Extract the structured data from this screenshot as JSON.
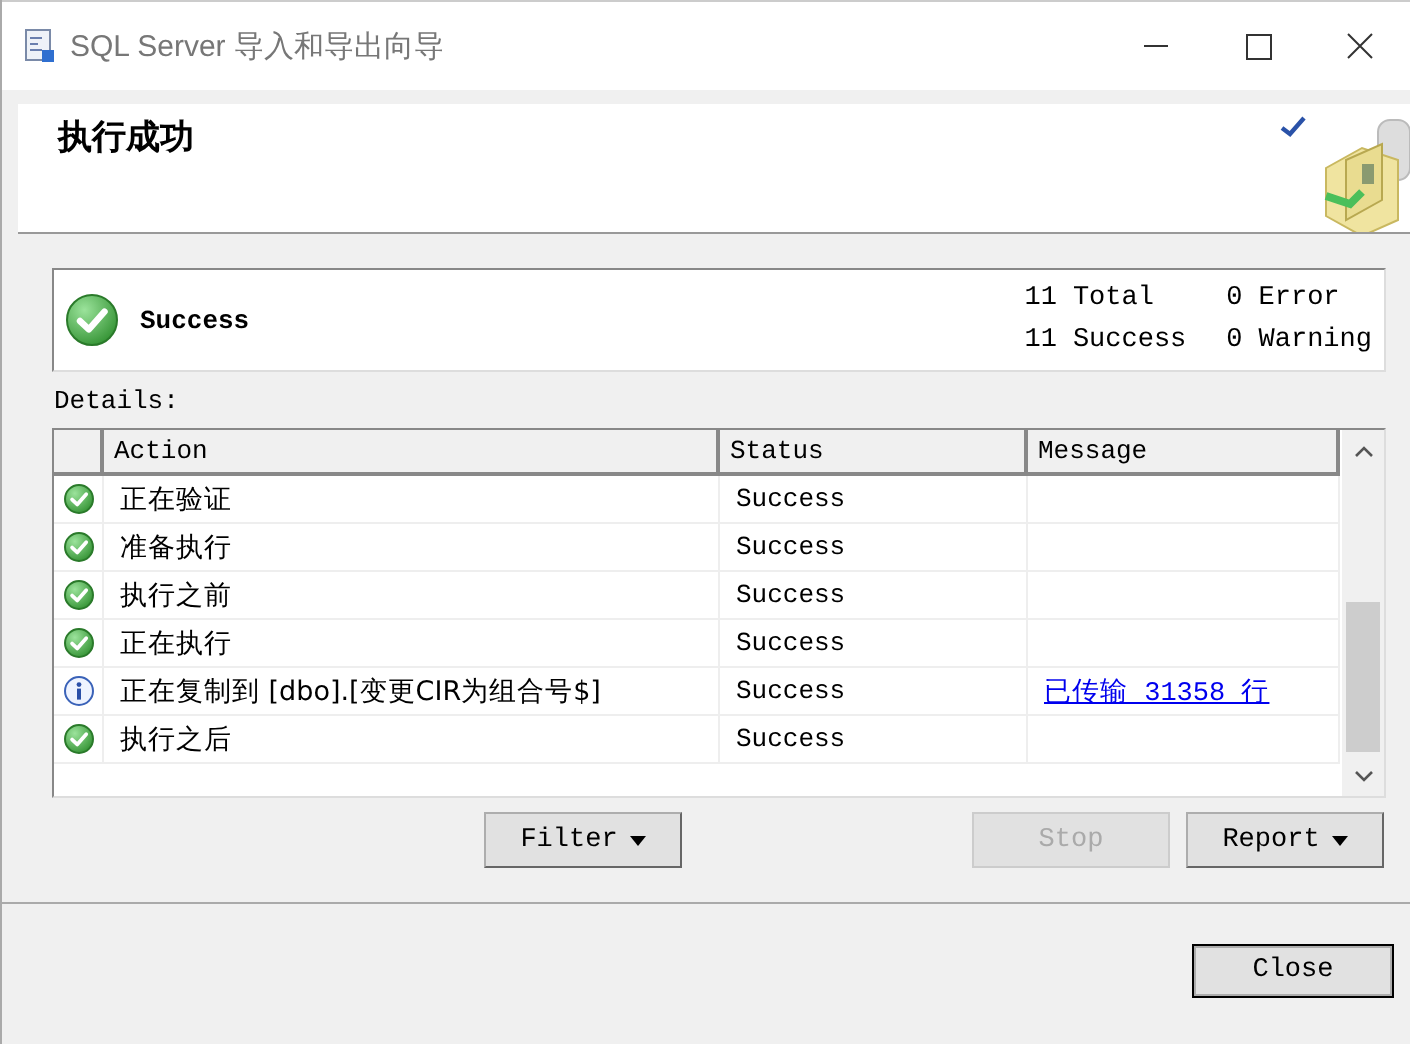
{
  "window": {
    "title": "SQL Server 导入和导出向导"
  },
  "header": {
    "title": "执行成功"
  },
  "summary": {
    "status": "Success",
    "counts": [
      {
        "number": "11",
        "label": "Total"
      },
      {
        "number": "0",
        "label": "Error"
      },
      {
        "number": "11",
        "label": "Success"
      },
      {
        "number": "0",
        "label": "Warning"
      }
    ]
  },
  "details_label": "Details:",
  "table": {
    "columns": [
      "Action",
      "Status",
      "Message"
    ],
    "rows": [
      {
        "kind": "success",
        "action": "正在验证",
        "status": "Success"
      },
      {
        "kind": "success",
        "action": "准备执行",
        "status": "Success"
      },
      {
        "kind": "success",
        "action": "执行之前",
        "status": "Success"
      },
      {
        "kind": "success",
        "action": "正在执行",
        "status": "Success"
      },
      {
        "kind": "info",
        "action": "正在复制到 [dbo].[变更CIR为组合号$]",
        "status": "Success",
        "message": "已传输 31358 行"
      },
      {
        "kind": "success",
        "action": "执行之后",
        "status": "Success"
      }
    ]
  },
  "buttons": [
    {
      "label": "Filter",
      "dropdown": true,
      "disabled": false
    },
    {
      "label": "Stop",
      "dropdown": false,
      "disabled": true
    },
    {
      "label": "Report",
      "dropdown": true,
      "disabled": false
    }
  ],
  "footer": {
    "close": "Close"
  }
}
